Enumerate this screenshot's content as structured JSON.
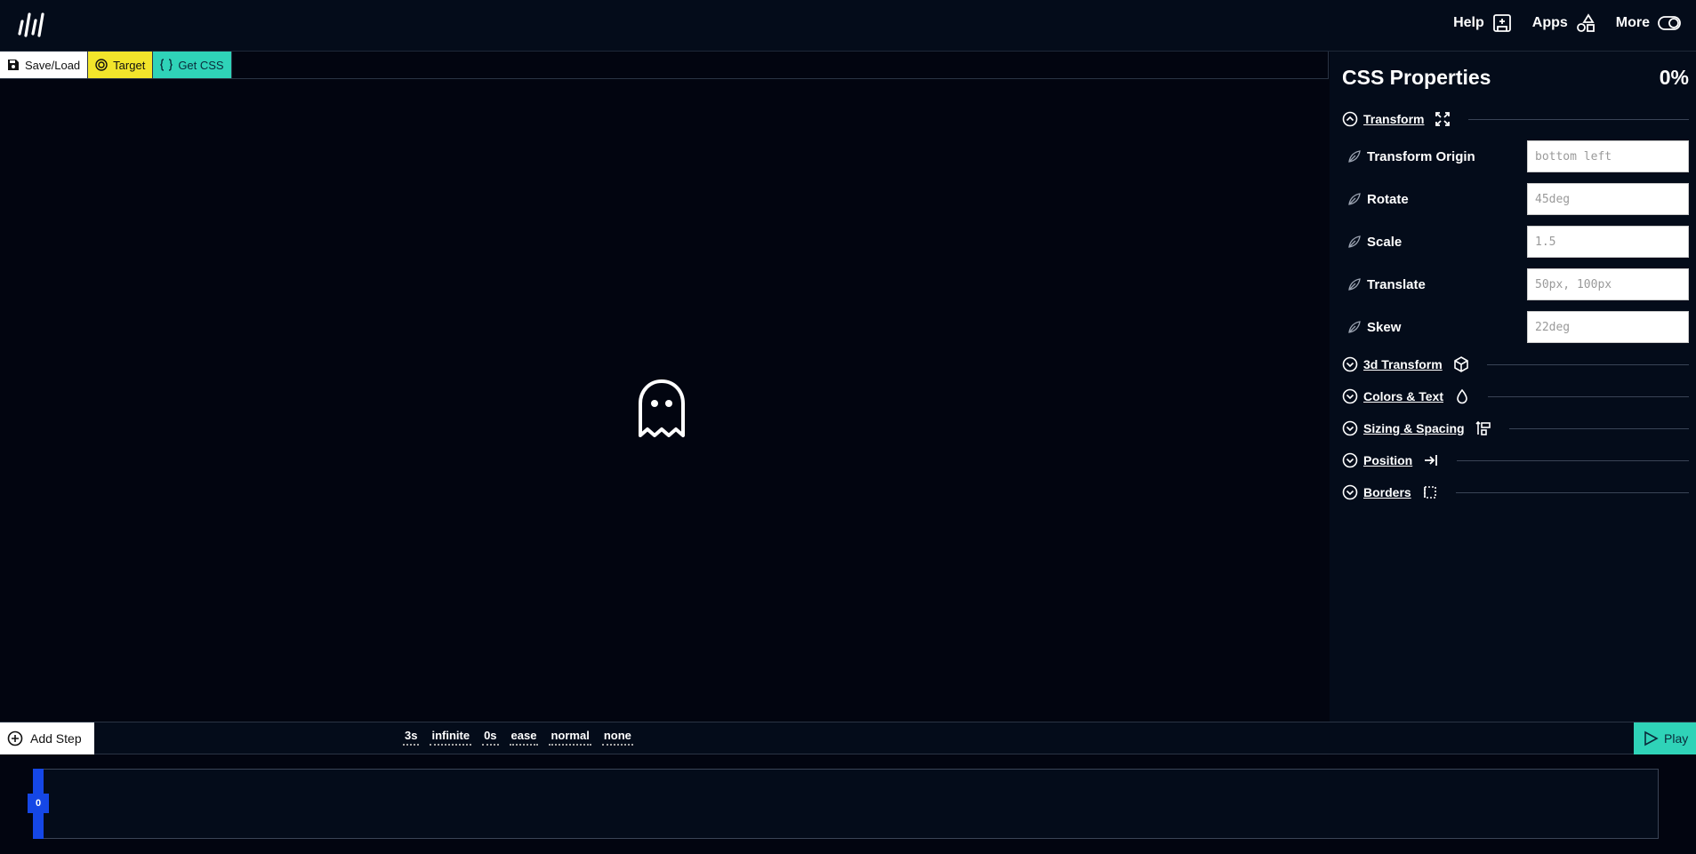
{
  "topnav": {
    "help": "Help",
    "apps": "Apps",
    "more": "More"
  },
  "toolbar": {
    "save_load": "Save/Load",
    "target": "Target",
    "get_css": "Get CSS"
  },
  "panel": {
    "title": "CSS Properties",
    "percent": "0%",
    "sections": {
      "transform": "Transform",
      "transform_3d": "3d Transform",
      "colors_text": "Colors & Text",
      "sizing_spacing": "Sizing & Spacing",
      "position": "Position",
      "borders": "Borders"
    },
    "transform_props": [
      {
        "label": "Transform Origin",
        "placeholder": "bottom left"
      },
      {
        "label": "Rotate",
        "placeholder": "45deg"
      },
      {
        "label": "Scale",
        "placeholder": "1.5"
      },
      {
        "label": "Translate",
        "placeholder": "50px, 100px"
      },
      {
        "label": "Skew",
        "placeholder": "22deg"
      }
    ]
  },
  "timeline": {
    "add_step": "Add Step",
    "settings": {
      "duration": "3s",
      "iterations": "infinite",
      "delay": "0s",
      "easing": "ease",
      "direction": "normal",
      "fill_mode": "none"
    },
    "play": "Play",
    "step_marker": "0"
  },
  "colors": {
    "accent_teal": "#2fd3b8",
    "accent_yellow": "#f2e52b",
    "marker_blue": "#1547e6",
    "background": "#020510"
  }
}
